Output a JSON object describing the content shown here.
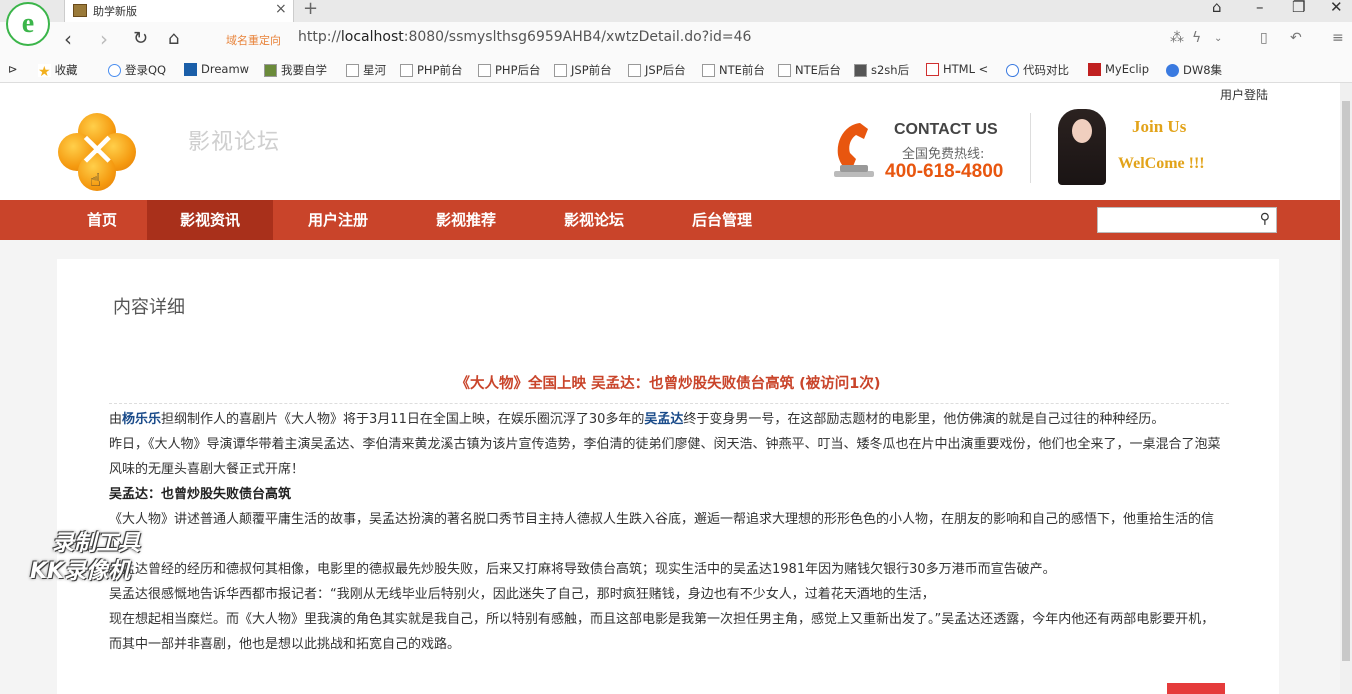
{
  "browser": {
    "tab_title": "助学新版",
    "redirect_label": "域名重定向",
    "url_prefix": "http://",
    "url_host": "localhost",
    "url_rest": ":8080/ssmyslthsg6959AHB4/xwtzDetail.do?id=46",
    "bookmarks": [
      "收藏",
      "登录QQ",
      "Dreamw",
      "我要自学",
      "星河",
      "PHP前台",
      "PHP后台",
      "JSP前台",
      "JSP后台",
      "NTE前台",
      "NTE后台",
      "s2sh后",
      "HTML <",
      "代码对比",
      "MyEclip",
      "DW8集"
    ]
  },
  "header": {
    "user_login": "用户登陆",
    "site_title": "影视论坛",
    "contact_title": "CONTACT US",
    "contact_sub": "全国免费热线:",
    "contact_number": "400-618-4800",
    "join": "Join Us",
    "welcome": "WelCome !!!"
  },
  "nav": {
    "items": [
      "首页",
      "影视资讯",
      "用户注册",
      "影视推荐",
      "影视论坛",
      "后台管理"
    ],
    "active_index": 1,
    "search_placeholder": ""
  },
  "content": {
    "section_title": "内容详细",
    "article_title": "《大人物》全国上映 吴孟达：也曾炒股失败债台高筑 (被访问1次)",
    "p1_a": "由",
    "p1_hl1": "杨乐乐",
    "p1_b": "担纲制作人的喜剧片《大人物》将于3月11日在全国上映，在娱乐圈沉浮了30多年的",
    "p1_hl2": "吴孟达",
    "p1_c": "终于变身男一号，在这部励志题材的电影里，他仿佛演的就是自己过往的种种经历。",
    "p2": "昨日，《大人物》导演谭华带着主演吴孟达、李伯清来黄龙溪古镇为该片宣传造势，李伯清的徒弟们廖健、闵天浩、钟燕平、叮当、矮冬瓜也在片中出演重要戏份，他们也全来了，一桌混合了泡菜风味的无厘头喜剧大餐正式开席！",
    "p3": "吴孟达：也曾炒股失败债台高筑",
    "p4": "《大人物》讲述普通人颠覆平庸生活的故事，吴孟达扮演的著名脱口秀节目主持人德叔人生跌入谷底，邂逅一帮追求大理想的形形色色的小人物，在朋友的影响和自己的感悟下，他重拾生活的信心。",
    "p5": "吴孟达曾经的经历和德叔何其相像，电影里的德叔最先炒股失败，后来又打麻将导致债台高筑；现实生活中的吴孟达1981年因为赌钱欠银行30多万港币而宣告破产。",
    "p6": "吴孟达很感慨地告诉华西都市报记者：“我刚从无线毕业后特别火，因此迷失了自己，那时疯狂赌钱，身边也有不少女人，过着花天酒地的生活，",
    "p7": "现在想起相当糜烂。而《大人物》里我演的角色其实就是我自己，所以特别有感触，而且这部电影是我第一次担任男主角，感觉上又重新出发了。”吴孟达还透露，今年内他还有两部电影要开机，而其中一部并非喜剧，他也是想以此挑战和拓宽自己的戏路。"
  },
  "watermark": {
    "line1": "录制工具",
    "line2": "KK录像机"
  },
  "colors": {
    "nav_bg": "#c9442a",
    "nav_active": "#a9301b",
    "title_red": "#c9442a",
    "hotline_orange": "#e8560f",
    "join_gold": "#e2a31a"
  }
}
